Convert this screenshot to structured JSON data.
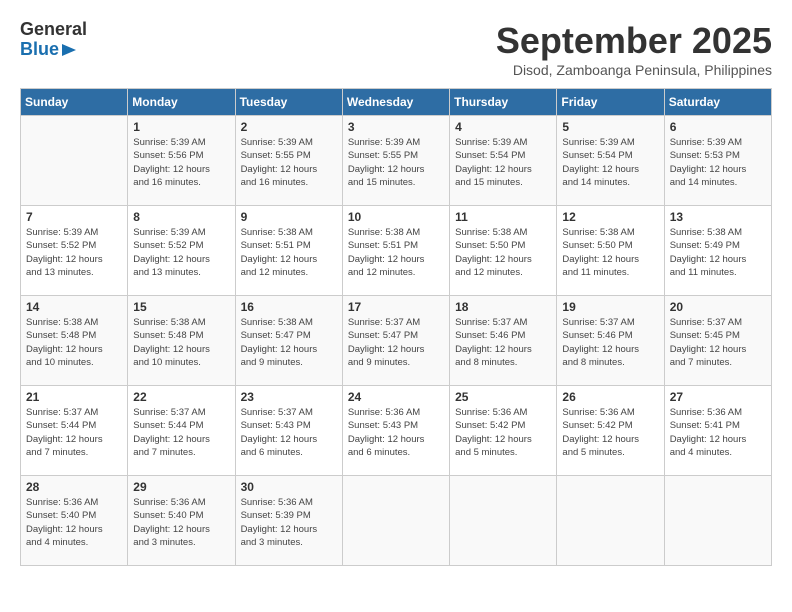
{
  "header": {
    "logo_line1": "General",
    "logo_line2": "Blue",
    "month_year": "September 2025",
    "location": "Disod, Zamboanga Peninsula, Philippines"
  },
  "days_of_week": [
    "Sunday",
    "Monday",
    "Tuesday",
    "Wednesday",
    "Thursday",
    "Friday",
    "Saturday"
  ],
  "weeks": [
    [
      {
        "day": "",
        "info": ""
      },
      {
        "day": "1",
        "info": "Sunrise: 5:39 AM\nSunset: 5:56 PM\nDaylight: 12 hours\nand 16 minutes."
      },
      {
        "day": "2",
        "info": "Sunrise: 5:39 AM\nSunset: 5:55 PM\nDaylight: 12 hours\nand 16 minutes."
      },
      {
        "day": "3",
        "info": "Sunrise: 5:39 AM\nSunset: 5:55 PM\nDaylight: 12 hours\nand 15 minutes."
      },
      {
        "day": "4",
        "info": "Sunrise: 5:39 AM\nSunset: 5:54 PM\nDaylight: 12 hours\nand 15 minutes."
      },
      {
        "day": "5",
        "info": "Sunrise: 5:39 AM\nSunset: 5:54 PM\nDaylight: 12 hours\nand 14 minutes."
      },
      {
        "day": "6",
        "info": "Sunrise: 5:39 AM\nSunset: 5:53 PM\nDaylight: 12 hours\nand 14 minutes."
      }
    ],
    [
      {
        "day": "7",
        "info": "Sunrise: 5:39 AM\nSunset: 5:52 PM\nDaylight: 12 hours\nand 13 minutes."
      },
      {
        "day": "8",
        "info": "Sunrise: 5:39 AM\nSunset: 5:52 PM\nDaylight: 12 hours\nand 13 minutes."
      },
      {
        "day": "9",
        "info": "Sunrise: 5:38 AM\nSunset: 5:51 PM\nDaylight: 12 hours\nand 12 minutes."
      },
      {
        "day": "10",
        "info": "Sunrise: 5:38 AM\nSunset: 5:51 PM\nDaylight: 12 hours\nand 12 minutes."
      },
      {
        "day": "11",
        "info": "Sunrise: 5:38 AM\nSunset: 5:50 PM\nDaylight: 12 hours\nand 12 minutes."
      },
      {
        "day": "12",
        "info": "Sunrise: 5:38 AM\nSunset: 5:50 PM\nDaylight: 12 hours\nand 11 minutes."
      },
      {
        "day": "13",
        "info": "Sunrise: 5:38 AM\nSunset: 5:49 PM\nDaylight: 12 hours\nand 11 minutes."
      }
    ],
    [
      {
        "day": "14",
        "info": "Sunrise: 5:38 AM\nSunset: 5:48 PM\nDaylight: 12 hours\nand 10 minutes."
      },
      {
        "day": "15",
        "info": "Sunrise: 5:38 AM\nSunset: 5:48 PM\nDaylight: 12 hours\nand 10 minutes."
      },
      {
        "day": "16",
        "info": "Sunrise: 5:38 AM\nSunset: 5:47 PM\nDaylight: 12 hours\nand 9 minutes."
      },
      {
        "day": "17",
        "info": "Sunrise: 5:37 AM\nSunset: 5:47 PM\nDaylight: 12 hours\nand 9 minutes."
      },
      {
        "day": "18",
        "info": "Sunrise: 5:37 AM\nSunset: 5:46 PM\nDaylight: 12 hours\nand 8 minutes."
      },
      {
        "day": "19",
        "info": "Sunrise: 5:37 AM\nSunset: 5:46 PM\nDaylight: 12 hours\nand 8 minutes."
      },
      {
        "day": "20",
        "info": "Sunrise: 5:37 AM\nSunset: 5:45 PM\nDaylight: 12 hours\nand 7 minutes."
      }
    ],
    [
      {
        "day": "21",
        "info": "Sunrise: 5:37 AM\nSunset: 5:44 PM\nDaylight: 12 hours\nand 7 minutes."
      },
      {
        "day": "22",
        "info": "Sunrise: 5:37 AM\nSunset: 5:44 PM\nDaylight: 12 hours\nand 7 minutes."
      },
      {
        "day": "23",
        "info": "Sunrise: 5:37 AM\nSunset: 5:43 PM\nDaylight: 12 hours\nand 6 minutes."
      },
      {
        "day": "24",
        "info": "Sunrise: 5:36 AM\nSunset: 5:43 PM\nDaylight: 12 hours\nand 6 minutes."
      },
      {
        "day": "25",
        "info": "Sunrise: 5:36 AM\nSunset: 5:42 PM\nDaylight: 12 hours\nand 5 minutes."
      },
      {
        "day": "26",
        "info": "Sunrise: 5:36 AM\nSunset: 5:42 PM\nDaylight: 12 hours\nand 5 minutes."
      },
      {
        "day": "27",
        "info": "Sunrise: 5:36 AM\nSunset: 5:41 PM\nDaylight: 12 hours\nand 4 minutes."
      }
    ],
    [
      {
        "day": "28",
        "info": "Sunrise: 5:36 AM\nSunset: 5:40 PM\nDaylight: 12 hours\nand 4 minutes."
      },
      {
        "day": "29",
        "info": "Sunrise: 5:36 AM\nSunset: 5:40 PM\nDaylight: 12 hours\nand 3 minutes."
      },
      {
        "day": "30",
        "info": "Sunrise: 5:36 AM\nSunset: 5:39 PM\nDaylight: 12 hours\nand 3 minutes."
      },
      {
        "day": "",
        "info": ""
      },
      {
        "day": "",
        "info": ""
      },
      {
        "day": "",
        "info": ""
      },
      {
        "day": "",
        "info": ""
      }
    ]
  ]
}
